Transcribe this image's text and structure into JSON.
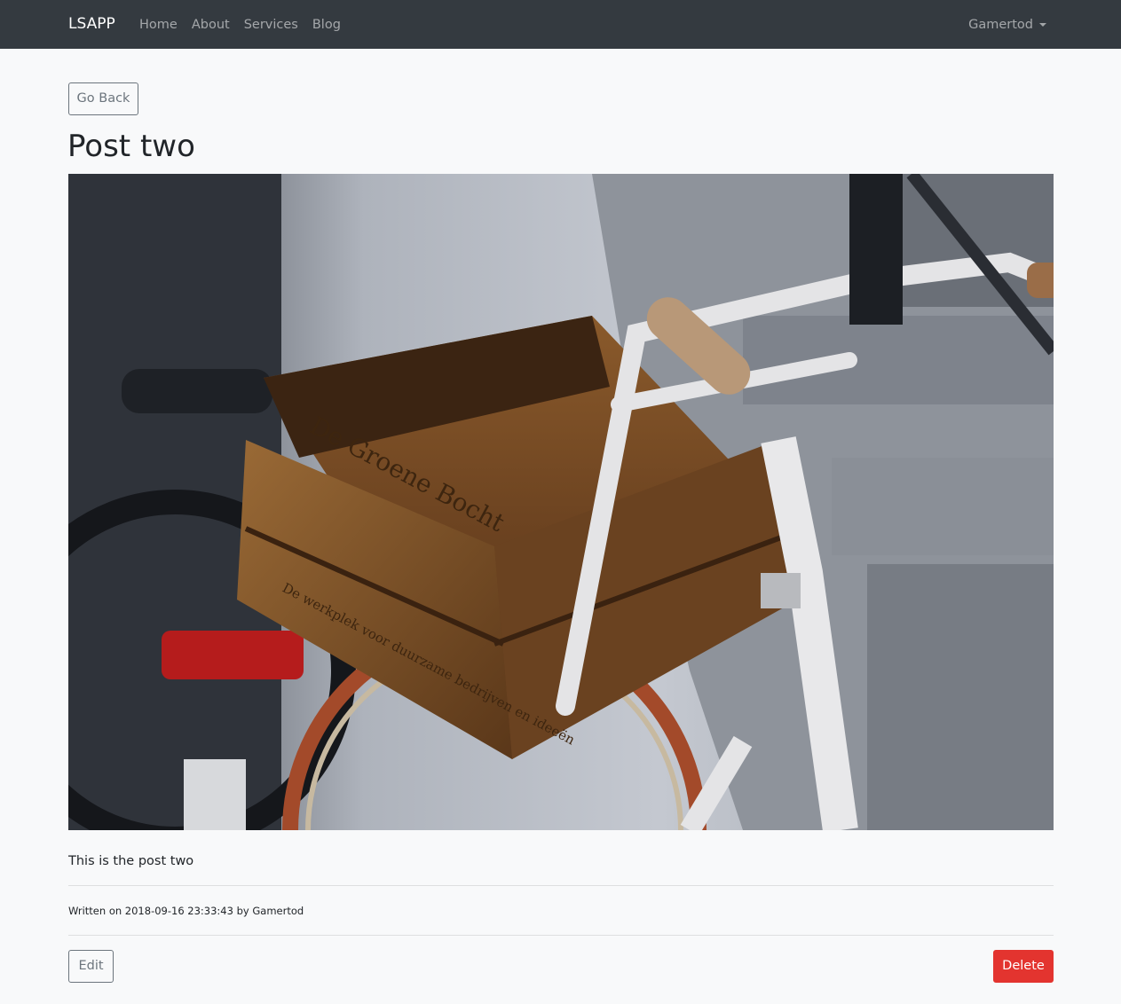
{
  "navbar": {
    "brand": "LSAPP",
    "links": [
      "Home",
      "About",
      "Services",
      "Blog"
    ],
    "user": "Gamertod"
  },
  "buttons": {
    "go_back": "Go Back",
    "edit": "Edit",
    "delete": "Delete"
  },
  "post": {
    "title": "Post two",
    "body": "This is the post two",
    "meta_prefix": "Written on",
    "date": "2018-09-16 23:33:43",
    "meta_by": "by",
    "author": "Gamertod",
    "image_text_top": "De Groene Bocht",
    "image_text_bottom": "De werkplek voor duurzame bedrijven en ideeën"
  },
  "colors": {
    "navbar": "#343a40",
    "delete": "#e3342f"
  }
}
